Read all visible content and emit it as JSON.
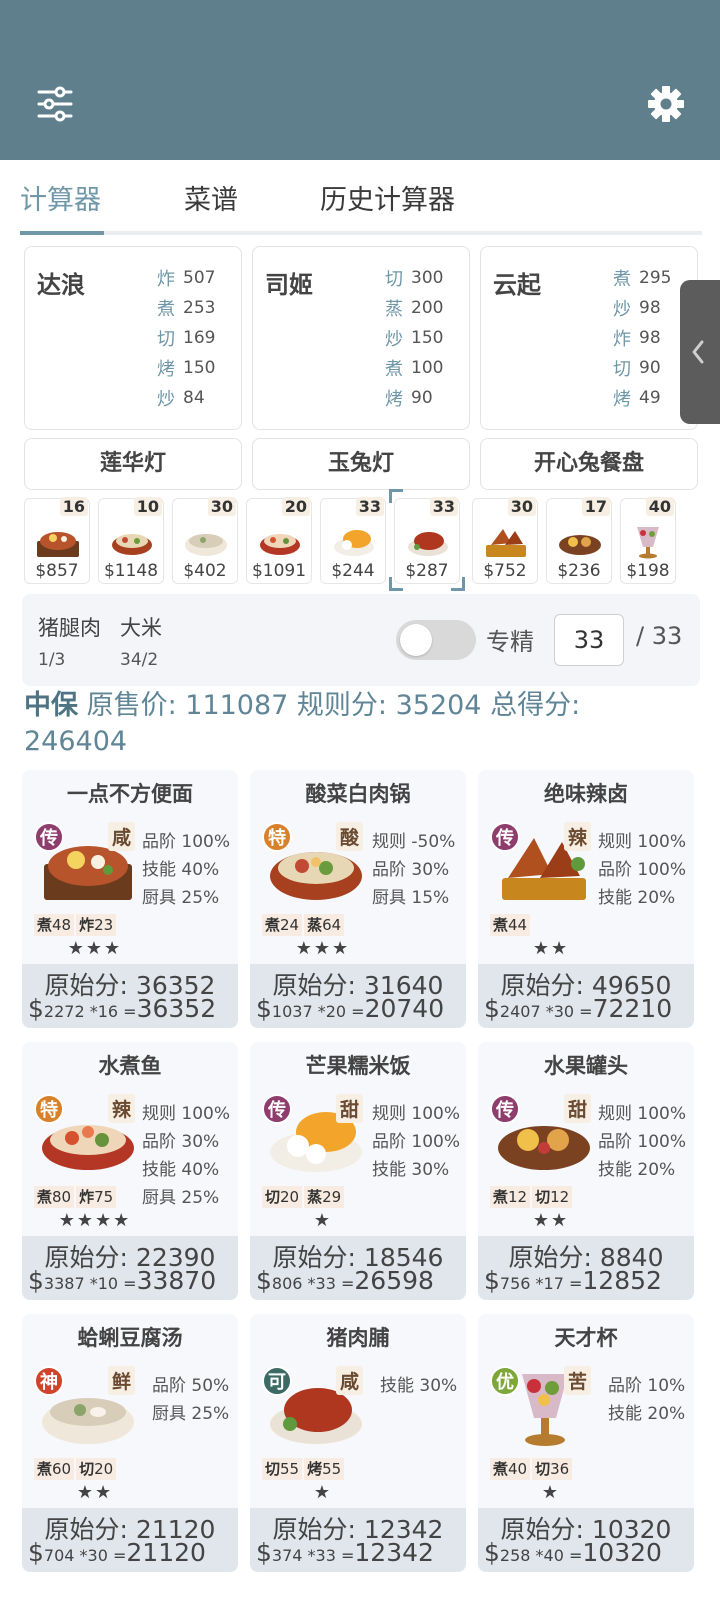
{
  "tabs": [
    {
      "label": "计算器",
      "active": true
    },
    {
      "label": "菜谱",
      "active": false
    },
    {
      "label": "历史计算器",
      "active": false
    }
  ],
  "colors": {
    "topbar": "#5f7f8d",
    "accent": "#6f97a8"
  },
  "chefs": [
    {
      "name": "达浪",
      "skills": [
        {
          "k": "炸",
          "v": "507"
        },
        {
          "k": "煮",
          "v": "253"
        },
        {
          "k": "切",
          "v": "169"
        },
        {
          "k": "烤",
          "v": "150"
        },
        {
          "k": "炒",
          "v": "84"
        }
      ]
    },
    {
      "name": "司姬",
      "skills": [
        {
          "k": "切",
          "v": "300"
        },
        {
          "k": "蒸",
          "v": "200"
        },
        {
          "k": "炒",
          "v": "150"
        },
        {
          "k": "煮",
          "v": "100"
        },
        {
          "k": "烤",
          "v": "90"
        }
      ]
    },
    {
      "name": "云起",
      "skills": [
        {
          "k": "煮",
          "v": "295"
        },
        {
          "k": "炒",
          "v": "98"
        },
        {
          "k": "炸",
          "v": "98"
        },
        {
          "k": "切",
          "v": "90"
        },
        {
          "k": "烤",
          "v": "49"
        }
      ]
    }
  ],
  "equipment": [
    "莲华灯",
    "玉兔灯",
    "开心兔餐盘"
  ],
  "dish_strip": [
    {
      "count": "16",
      "price": "$857"
    },
    {
      "count": "10",
      "price": "$1148"
    },
    {
      "count": "30",
      "price": "$402"
    },
    {
      "count": "20",
      "price": "$1091"
    },
    {
      "count": "33",
      "price": "$244"
    },
    {
      "count": "33",
      "price": "$287",
      "selected": true
    },
    {
      "count": "30",
      "price": "$752"
    },
    {
      "count": "17",
      "price": "$236"
    },
    {
      "count": "40",
      "price": "$198"
    }
  ],
  "ingredients": [
    {
      "name": "猪腿肉",
      "qty": "1/3"
    },
    {
      "name": "大米",
      "qty": "34/2"
    }
  ],
  "specialize": {
    "label": "专精",
    "on": false,
    "value": "33",
    "max": "/ 33"
  },
  "summary": {
    "grade": "中保",
    "text1": " 原售价:  111087 规则分:  35204 总得分:",
    "text2": "246404"
  },
  "cards": [
    {
      "title": "一点不方便面",
      "rarity": "传",
      "rarity_color": "#8e3d6c",
      "flavor": "咸",
      "bonuses": [
        "品阶 100%",
        "技能 40%",
        "厨具 25%"
      ],
      "reqs": [
        {
          "k": "煮",
          "v": "48"
        },
        {
          "k": "炸",
          "v": "23"
        }
      ],
      "stars": "★★★",
      "raw": "原始分: 36352",
      "price": "2272",
      "mult": "*16",
      "eq": "=",
      "total": "36352"
    },
    {
      "title": "酸菜白肉锅",
      "rarity": "特",
      "rarity_color": "#d9802a",
      "flavor": "酸",
      "bonuses": [
        "规则 -50%",
        "品阶 30%",
        "厨具 15%"
      ],
      "reqs": [
        {
          "k": "煮",
          "v": "24"
        },
        {
          "k": "蒸",
          "v": "64"
        }
      ],
      "stars": "★★★",
      "raw": "原始分: 31640",
      "price": "1037",
      "mult": "*20",
      "eq": "=",
      "total": "20740"
    },
    {
      "title": "绝味辣卤",
      "rarity": "传",
      "rarity_color": "#8e3d6c",
      "flavor": "辣",
      "bonuses": [
        "规则 100%",
        "品阶 100%",
        "技能 20%"
      ],
      "reqs": [
        {
          "k": "煮",
          "v": "44"
        }
      ],
      "stars": "★★",
      "raw": "原始分: 49650",
      "price": "2407",
      "mult": "*30",
      "eq": "=",
      "total": "72210"
    },
    {
      "title": "水煮鱼",
      "rarity": "特",
      "rarity_color": "#d9802a",
      "flavor": "辣",
      "bonuses": [
        "规则 100%",
        "品阶 30%",
        "技能 40%",
        "厨具 25%"
      ],
      "reqs": [
        {
          "k": "煮",
          "v": "80"
        },
        {
          "k": "炸",
          "v": "75"
        }
      ],
      "stars": "★★★★",
      "raw": "原始分: 22390",
      "price": "3387",
      "mult": "*10",
      "eq": "=",
      "total": "33870"
    },
    {
      "title": "芒果糯米饭",
      "rarity": "传",
      "rarity_color": "#8e3d6c",
      "flavor": "甜",
      "bonuses": [
        "规则 100%",
        "品阶 100%",
        "技能 30%"
      ],
      "reqs": [
        {
          "k": "切",
          "v": "20"
        },
        {
          "k": "蒸",
          "v": "29"
        }
      ],
      "stars": "★",
      "raw": "原始分: 18546",
      "price": "806",
      "mult": "*33",
      "eq": "=",
      "total": "26598"
    },
    {
      "title": "水果罐头",
      "rarity": "传",
      "rarity_color": "#8e3d6c",
      "flavor": "甜",
      "bonuses": [
        "规则 100%",
        "品阶 100%",
        "技能 20%"
      ],
      "reqs": [
        {
          "k": "煮",
          "v": "12"
        },
        {
          "k": "切",
          "v": "12"
        }
      ],
      "stars": "★★",
      "raw": "原始分: 8840",
      "price": "756",
      "mult": "*17",
      "eq": "=",
      "total": "12852"
    },
    {
      "title": "蛤蜊豆腐汤",
      "rarity": "神",
      "rarity_color": "#d0442c",
      "flavor": "鲜",
      "bonuses": [
        "品阶 50%",
        "厨具 25%"
      ],
      "reqs": [
        {
          "k": "煮",
          "v": "60"
        },
        {
          "k": "切",
          "v": "20"
        }
      ],
      "stars": "★★",
      "raw": "原始分: 21120",
      "price": "704",
      "mult": "*30",
      "eq": "=",
      "total": "21120"
    },
    {
      "title": "猪肉脯",
      "rarity": "可",
      "rarity_color": "#3d6a64",
      "flavor": "咸",
      "bonuses": [
        "技能 30%"
      ],
      "reqs": [
        {
          "k": "切",
          "v": "55"
        },
        {
          "k": "烤",
          "v": "55"
        }
      ],
      "stars": "★",
      "raw": "原始分: 12342",
      "price": "374",
      "mult": "*33",
      "eq": "=",
      "total": "12342"
    },
    {
      "title": "天才杯",
      "rarity": "优",
      "rarity_color": "#7ea73a",
      "flavor": "苦",
      "bonuses": [
        "品阶 10%",
        "技能 20%"
      ],
      "reqs": [
        {
          "k": "煮",
          "v": "40"
        },
        {
          "k": "切",
          "v": "36"
        }
      ],
      "stars": "★",
      "raw": "原始分: 10320",
      "price": "258",
      "mult": "*40",
      "eq": "=",
      "total": "10320"
    }
  ]
}
